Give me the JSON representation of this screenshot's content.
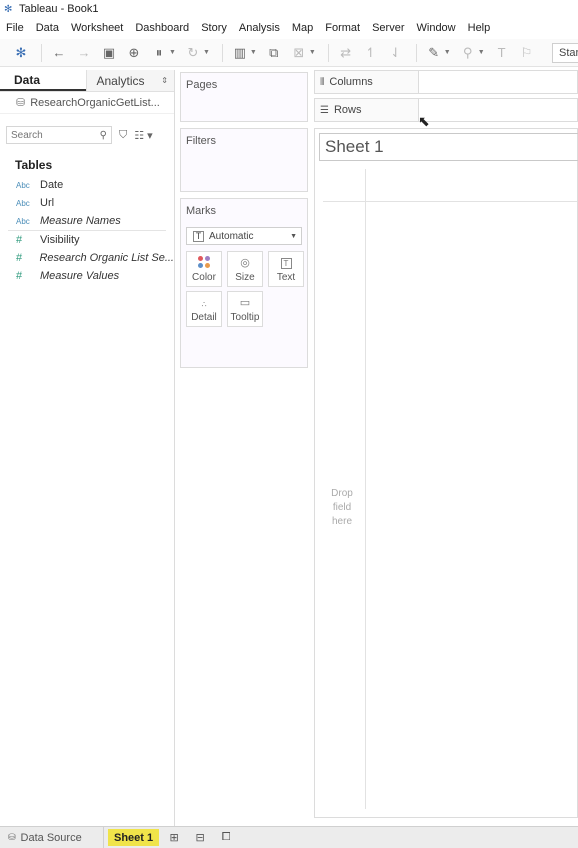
{
  "window": {
    "title": "Tableau - Book1",
    "app_icon": "tableau-logo-icon"
  },
  "menu": {
    "items": [
      "File",
      "Data",
      "Worksheet",
      "Dashboard",
      "Story",
      "Analysis",
      "Map",
      "Format",
      "Server",
      "Window",
      "Help"
    ]
  },
  "toolbar": {
    "show_me_label": "Star"
  },
  "data_pane": {
    "tab_data": "Data",
    "tab_analytics": "Analytics",
    "data_source": "ResearchOrganicGetList...",
    "search_placeholder": "Search",
    "tables_heading": "Tables",
    "dimensions": [
      {
        "type": "Abc",
        "name": "Date"
      },
      {
        "type": "Abc",
        "name": "Url"
      },
      {
        "type": "Abc",
        "name": "Measure Names"
      }
    ],
    "measures": [
      {
        "type": "#",
        "name": "Visibility"
      },
      {
        "type": "#",
        "name": "Research Organic List Se..."
      },
      {
        "type": "#",
        "name": "Measure Values"
      }
    ]
  },
  "cards": {
    "pages": "Pages",
    "filters": "Filters",
    "marks": "Marks",
    "mark_type": "Automatic",
    "mark_buttons": {
      "color": "Color",
      "size": "Size",
      "text": "Text",
      "detail": "Detail",
      "tooltip": "Tooltip"
    },
    "color_dots": [
      "#e0585d",
      "#9e7fc4",
      "#5d8fc8",
      "#e89b4d"
    ]
  },
  "view": {
    "columns_label": "Columns",
    "rows_label": "Rows",
    "sheet_title": "Sheet 1",
    "drop_hint": "Drop field here"
  },
  "bottom": {
    "data_source_tab": "Data Source",
    "sheet_tab": "Sheet 1"
  }
}
